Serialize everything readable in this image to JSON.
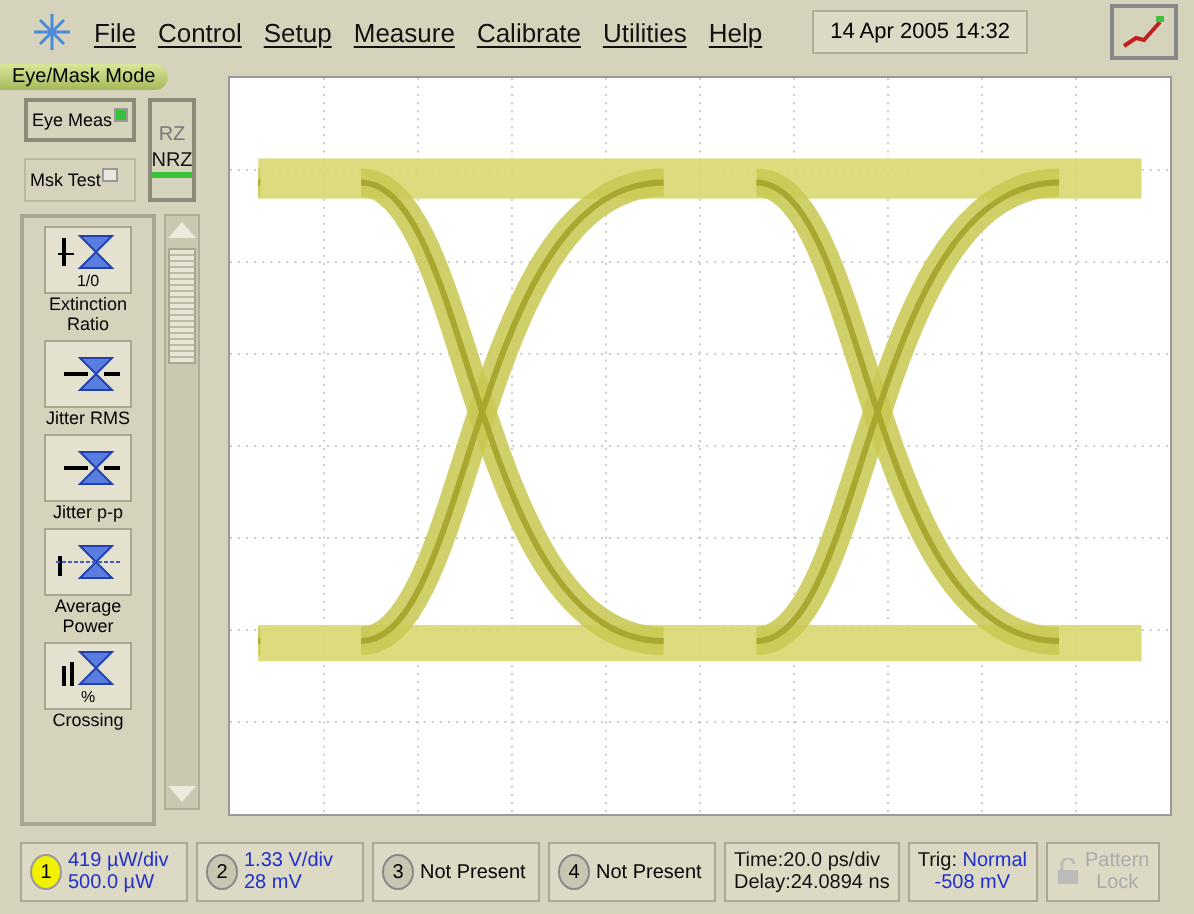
{
  "menu": {
    "items": [
      "File",
      "Control",
      "Setup",
      "Measure",
      "Calibrate",
      "Utilities",
      "Help"
    ]
  },
  "datetime": "14 Apr 2005  14:32",
  "mode_label": "Eye/Mask Mode",
  "mode_buttons": [
    {
      "label": "Eye Meas",
      "on": true
    },
    {
      "label": "Msk Test",
      "on": false
    }
  ],
  "format_toggle": [
    {
      "label": "RZ",
      "selected": false
    },
    {
      "label": "NRZ",
      "selected": true
    }
  ],
  "measurements": [
    {
      "kind": "extinction",
      "label": "Extinction Ratio",
      "icon_text": "1/0"
    },
    {
      "kind": "jitter-rms",
      "label": "Jitter RMS"
    },
    {
      "kind": "jitter-pp",
      "label": "Jitter p-p"
    },
    {
      "kind": "average-power",
      "label": "Average Power"
    },
    {
      "kind": "crossing",
      "label": "Crossing",
      "icon_text": "%"
    }
  ],
  "channels": [
    {
      "number": "1",
      "line1": "419 µW/div",
      "line2": "500.0 µW",
      "selected": true
    },
    {
      "number": "2",
      "line1": "1.33 V/div",
      "line2": "28 mV",
      "selected": false
    },
    {
      "number": "3",
      "line1": "Not Present",
      "selected": false
    },
    {
      "number": "4",
      "line1": "Not Present",
      "selected": false
    }
  ],
  "timebase": {
    "line1": "Time:20.0 ps/div",
    "line2": "Delay:24.0894 ns"
  },
  "trigger": {
    "label": "Trig:",
    "mode": "Normal",
    "level": "-508 mV"
  },
  "pattern_lock": {
    "line1": "Pattern",
    "line2": "Lock",
    "disabled": true
  }
}
